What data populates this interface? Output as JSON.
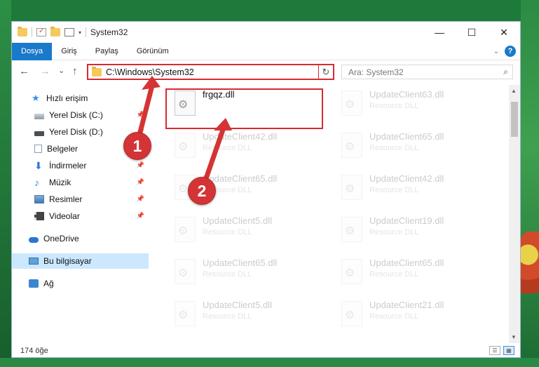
{
  "window": {
    "title": "System32",
    "controls": {
      "minimize": "—",
      "maximize": "☐",
      "close": "✕"
    }
  },
  "ribbon": {
    "tabs": [
      "Dosya",
      "Giriş",
      "Paylaş",
      "Görünüm"
    ],
    "help": "?"
  },
  "navigation": {
    "back": "←",
    "forward": "→",
    "recent": "⌄",
    "up": "↑",
    "address": "C:\\Windows\\System32",
    "refresh": "↻",
    "search_placeholder": "Ara: System32"
  },
  "sidebar": {
    "items": [
      {
        "label": "Hızlı erişim",
        "icon": "star-icon"
      },
      {
        "label": "Yerel Disk (C:)",
        "icon": "drive-icon",
        "pinned": true
      },
      {
        "label": "Yerel Disk (D:)",
        "icon": "drive-icon",
        "pinned": true
      },
      {
        "label": "Belgeler",
        "icon": "document-icon",
        "pinned": true
      },
      {
        "label": "İndirmeler",
        "icon": "download-icon",
        "pinned": true
      },
      {
        "label": "Müzik",
        "icon": "music-icon",
        "pinned": true
      },
      {
        "label": "Resimler",
        "icon": "pictures-icon",
        "pinned": true
      },
      {
        "label": "Videolar",
        "icon": "videos-icon",
        "pinned": true
      },
      {
        "label": "OneDrive",
        "icon": "onedrive-icon"
      },
      {
        "label": "Bu bilgisayar",
        "icon": "computer-icon",
        "selected": true
      },
      {
        "label": "Ağ",
        "icon": "network-icon"
      }
    ]
  },
  "files": {
    "highlighted": {
      "name": "frgqz.dll",
      "type": ""
    },
    "left_column": [
      {
        "name": "UpdateClient42.dll",
        "type": "Resource DLL"
      },
      {
        "name": "UpdateClient65.dll",
        "type": "Resource DLL"
      },
      {
        "name": "UpdateClient5.dll",
        "type": "Resource DLL"
      },
      {
        "name": "UpdateClient65.dll",
        "type": "Resource DLL"
      },
      {
        "name": "UpdateClient5.dll",
        "type": "Resource DLL"
      }
    ],
    "right_column": [
      {
        "name": "UpdateClient63.dll",
        "type": "Resource DLL"
      },
      {
        "name": "UpdateClient65.dll",
        "type": "Resource DLL"
      },
      {
        "name": "UpdateClient42.dll",
        "type": "Resource DLL"
      },
      {
        "name": "UpdateClient19.dll",
        "type": "Resource DLL"
      },
      {
        "name": "UpdateClient65.dll",
        "type": "Resource DLL"
      },
      {
        "name": "UpdateClient21.dll",
        "type": "Resource DLL"
      }
    ]
  },
  "status": {
    "item_count": "174 öğe"
  },
  "annotations": {
    "step1": "1",
    "step2": "2",
    "color": "#d43436"
  }
}
